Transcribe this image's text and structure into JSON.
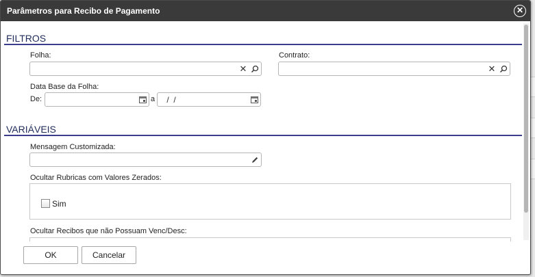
{
  "dialog": {
    "title": "Parâmetros para Recibo de Pagamento",
    "close_icon": "close-circle-icon"
  },
  "filtros": {
    "section_title": "FILTROS",
    "folha_label": "Folha:",
    "folha_value": "",
    "contrato_label": "Contrato:",
    "contrato_value": "",
    "data_base_label": "Data Base da Folha:",
    "de_label": "De:",
    "de_value": "",
    "a_label": "a",
    "a_value": " /  /"
  },
  "variaveis": {
    "section_title": "VARIÁVEIS",
    "mensagem_label": "Mensagem Customizada:",
    "mensagem_value": "",
    "ocultar_rubricas_label": "Ocultar Rubricas com Valores Zerados:",
    "sim_label": "Sim",
    "sim_checked": false,
    "ocultar_recibos_label": "Ocultar Recibos que não Possuam Venc/Desc:"
  },
  "footer": {
    "ok_label": "OK",
    "cancel_label": "Cancelar"
  }
}
